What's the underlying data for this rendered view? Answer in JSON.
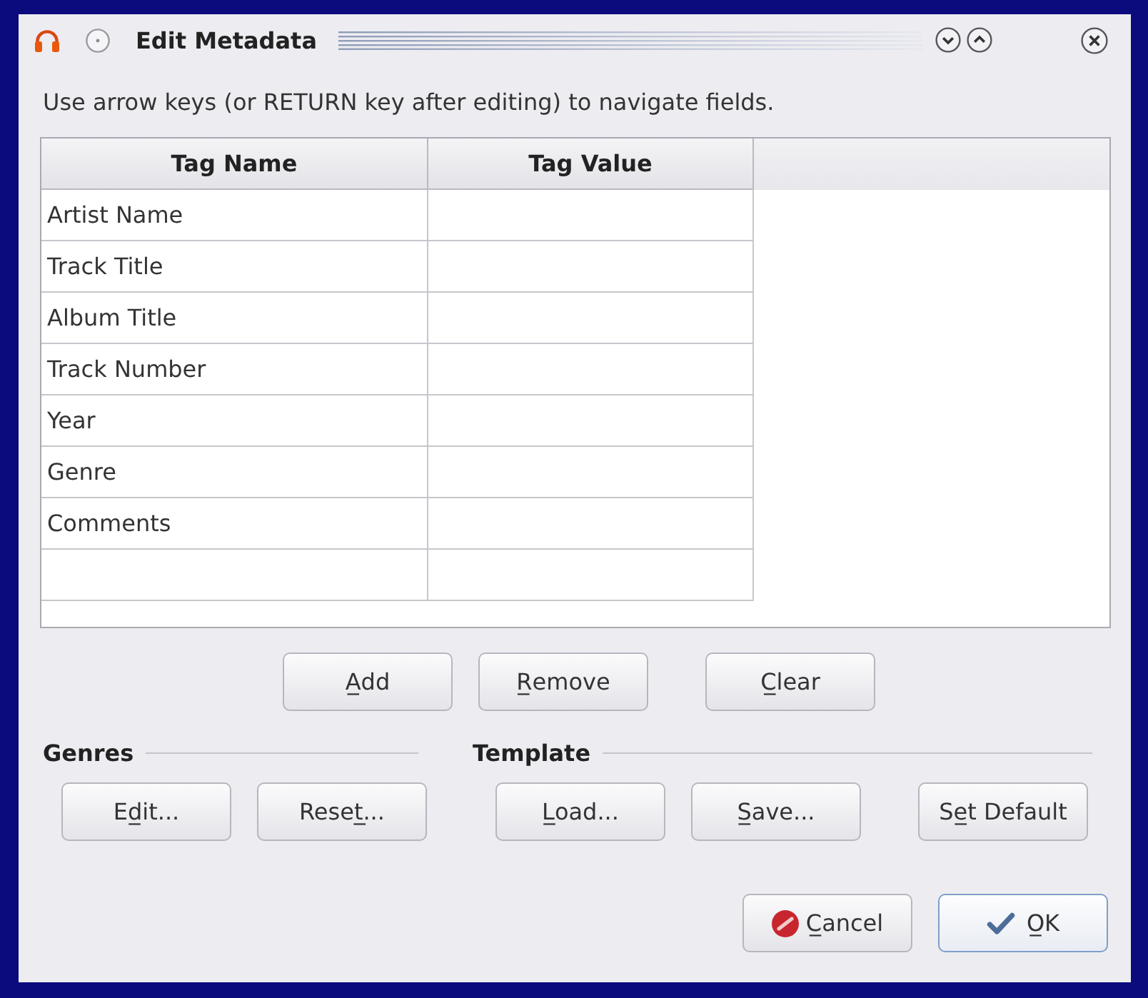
{
  "window": {
    "title": "Edit Metadata"
  },
  "instruction": "Use arrow keys (or RETURN key after editing) to navigate fields.",
  "table": {
    "columns": [
      "Tag Name",
      "Tag Value"
    ],
    "rows": [
      {
        "kind": "tag",
        "tag_name": "Artist Name"
      },
      {
        "kind": "tag",
        "tag_name": "Track Title"
      },
      {
        "kind": "tag",
        "tag_name": "Album Title"
      },
      {
        "kind": "tag",
        "tag_name": "Track Number"
      },
      {
        "kind": "tag",
        "tag_name": "Year"
      },
      {
        "kind": "tag",
        "tag_name": "Genre"
      },
      {
        "kind": "tag",
        "tag_name": "Comments"
      },
      {
        "kind": "blank"
      }
    ]
  },
  "table_buttons": [
    {
      "label": "A̲dd"
    },
    {
      "label": "R̲emove"
    },
    {
      "label": "C̲lear"
    }
  ],
  "groups": [
    {
      "title": "Genres",
      "buttons": [
        {
          "label": "Ed̲it..."
        },
        {
          "label": "Reset̲..."
        }
      ]
    },
    {
      "title": "Template",
      "buttons": [
        {
          "label": "L̲oad..."
        },
        {
          "label": "S̲ave..."
        },
        {
          "label": "Se̲t Default"
        }
      ]
    }
  ],
  "dialog_buttons": [
    {
      "kind": "cancel",
      "label": "C̲ancel",
      "default": false
    },
    {
      "kind": "ok",
      "label": "O̲K",
      "default": true
    }
  ]
}
